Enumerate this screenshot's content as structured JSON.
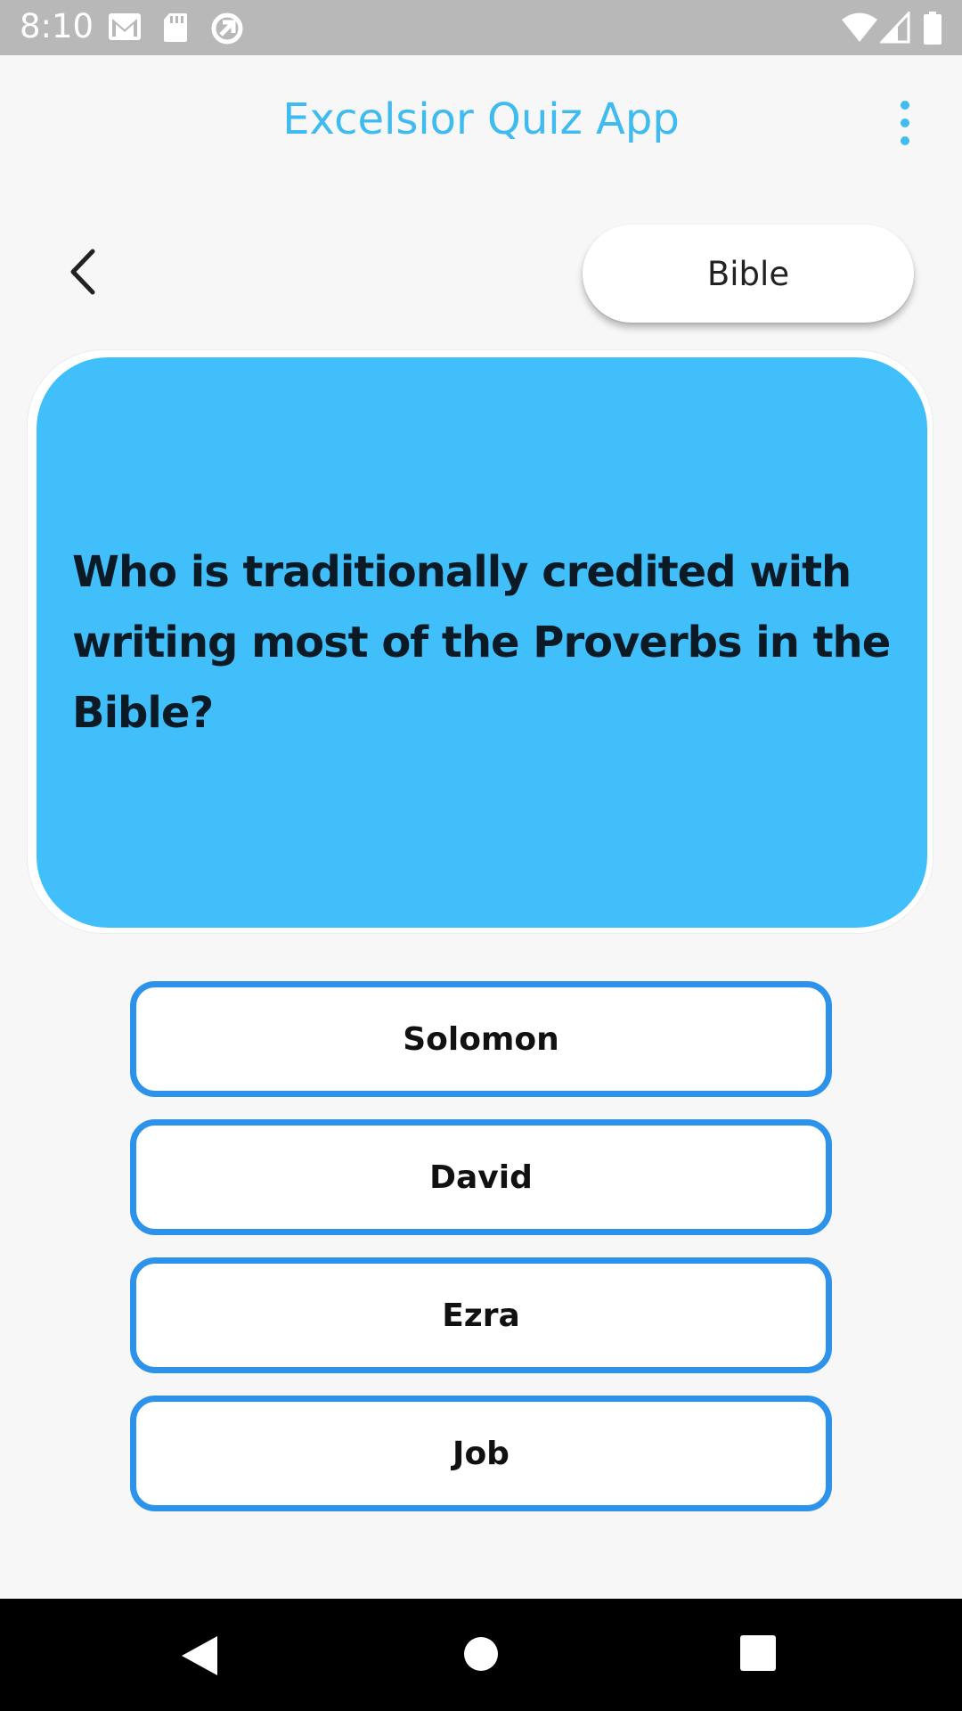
{
  "status_bar": {
    "time": "8:10",
    "icons": [
      "gmail-icon",
      "sd-card-icon",
      "sync-icon",
      "wifi-icon",
      "signal-icon",
      "battery-icon"
    ]
  },
  "app_bar": {
    "title": "Excelsior Quiz App",
    "menu_icon": "more-vert-icon"
  },
  "top_row": {
    "back_icon": "chevron-left-icon",
    "category": "Bible"
  },
  "question": {
    "text": "Who is traditionally credited with writing most of the Proverbs in the Bible?"
  },
  "answers": [
    {
      "label": "Solomon"
    },
    {
      "label": "David"
    },
    {
      "label": "Ezra"
    },
    {
      "label": "Job"
    }
  ],
  "nav_bar": {
    "buttons": [
      "back-triangle-icon",
      "home-circle-icon",
      "recents-square-icon"
    ]
  },
  "colors": {
    "accent": "#40bffa",
    "title": "#3fbbf0",
    "answer_border": "#2c92ea",
    "status_bar": "#b8b8b8",
    "background": "#f7f7f7"
  }
}
